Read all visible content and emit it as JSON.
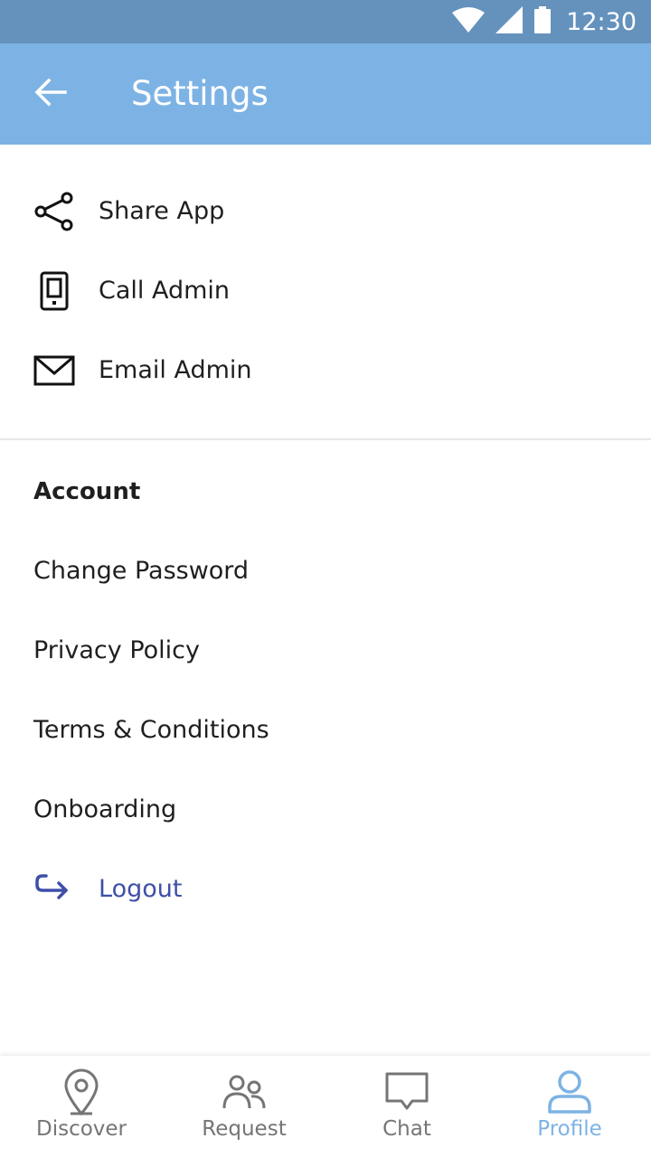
{
  "status_bar": {
    "time": "12:30"
  },
  "header": {
    "title": "Settings",
    "back_icon": "arrow-left-icon"
  },
  "quick_actions": [
    {
      "label": "Share App",
      "icon": "share-icon"
    },
    {
      "label": "Call Admin",
      "icon": "phone-icon"
    },
    {
      "label": "Email Admin",
      "icon": "mail-icon"
    }
  ],
  "account": {
    "header": "Account",
    "items": [
      {
        "label": "Change Password"
      },
      {
        "label": "Privacy Policy"
      },
      {
        "label": "Terms & Conditions"
      },
      {
        "label": "Onboarding"
      }
    ],
    "logout": {
      "label": "Logout",
      "icon": "logout-icon",
      "color": "#3d4fa8"
    }
  },
  "bottom_nav": {
    "items": [
      {
        "label": "Discover",
        "icon": "location-pin-icon",
        "active": false
      },
      {
        "label": "Request",
        "icon": "people-icon",
        "active": false
      },
      {
        "label": "Chat",
        "icon": "chat-icon",
        "active": false
      },
      {
        "label": "Profile",
        "icon": "user-icon",
        "active": true
      }
    ],
    "active_color": "#7db3e4",
    "inactive_color": "#757575"
  },
  "colors": {
    "status_bar": "#6592bd",
    "app_bar": "#7db3e4",
    "accent": "#3d4fa8"
  }
}
